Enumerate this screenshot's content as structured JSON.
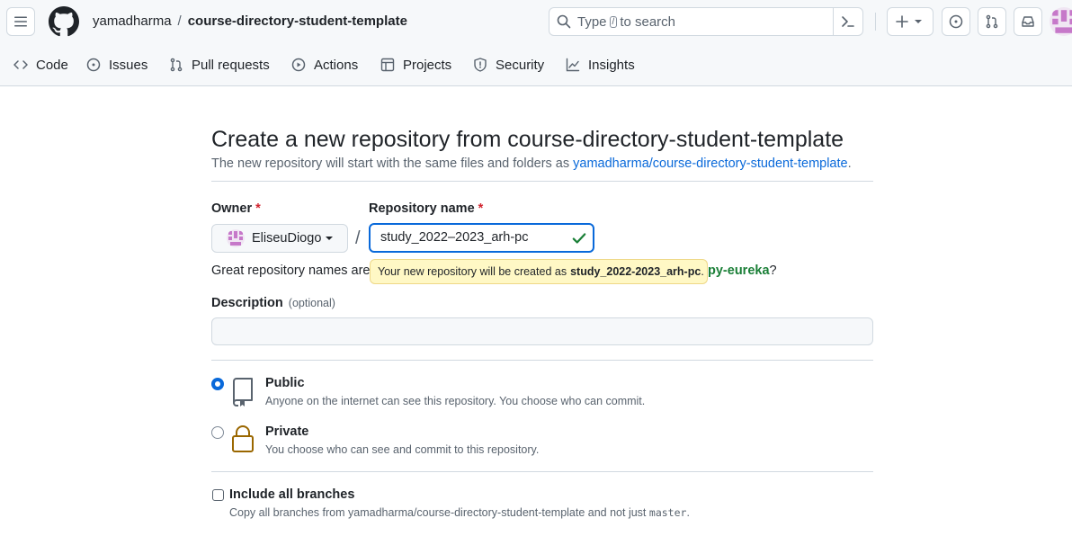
{
  "header": {
    "breadcrumb_owner": "yamadharma",
    "breadcrumb_separator": "/",
    "breadcrumb_repo": "course-directory-student-template",
    "search": {
      "prefix": "Type",
      "key": "/",
      "suffix": "to search"
    },
    "plus_label": "+"
  },
  "tabs": [
    {
      "label": "Code",
      "icon": "code-icon"
    },
    {
      "label": "Issues",
      "icon": "issue-opened-icon"
    },
    {
      "label": "Pull requests",
      "icon": "git-pull-request-icon"
    },
    {
      "label": "Actions",
      "icon": "play-icon"
    },
    {
      "label": "Projects",
      "icon": "table-icon"
    },
    {
      "label": "Security",
      "icon": "shield-icon"
    },
    {
      "label": "Insights",
      "icon": "graph-icon"
    }
  ],
  "page": {
    "title": "Create a new repository from course-directory-student-template",
    "subtitle_prefix": "The new repository will start with the same files and folders as",
    "subtitle_link": "yamadharma/course-directory-student-template",
    "subtitle_suffix": "."
  },
  "form": {
    "owner_label": "Owner",
    "required_mark": "*",
    "owner_value": "EliseuDiogo",
    "repo_name_label": "Repository name",
    "repo_name_value": "study_2022–2023_arh-pc",
    "slash": "/",
    "hint_prefix": "Great repository names are",
    "hint_suggestion": "py-eureka",
    "hint_suffix": "?",
    "tooltip_prefix": "Your new repository will be created as",
    "tooltip_name": "study_2022-2023_arh-pc",
    "tooltip_suffix": ".",
    "description_label": "Description",
    "description_optional": "(optional)",
    "description_value": ""
  },
  "visibility": {
    "selected": "public",
    "public_title": "Public",
    "public_desc": "Anyone on the internet can see this repository. You choose who can commit.",
    "private_title": "Private",
    "private_desc": "You choose who can see and commit to this repository."
  },
  "branches": {
    "title": "Include all branches",
    "desc_prefix": "Copy all branches from yamadharma/course-directory-student-template and not just",
    "desc_code": "master",
    "desc_suffix": ".",
    "checked": false
  },
  "colors": {
    "accent": "#0969da",
    "success": "#1a7f37",
    "danger": "#d1242f",
    "tooltip_bg": "#fff8c5",
    "lock": "#9a6700"
  }
}
